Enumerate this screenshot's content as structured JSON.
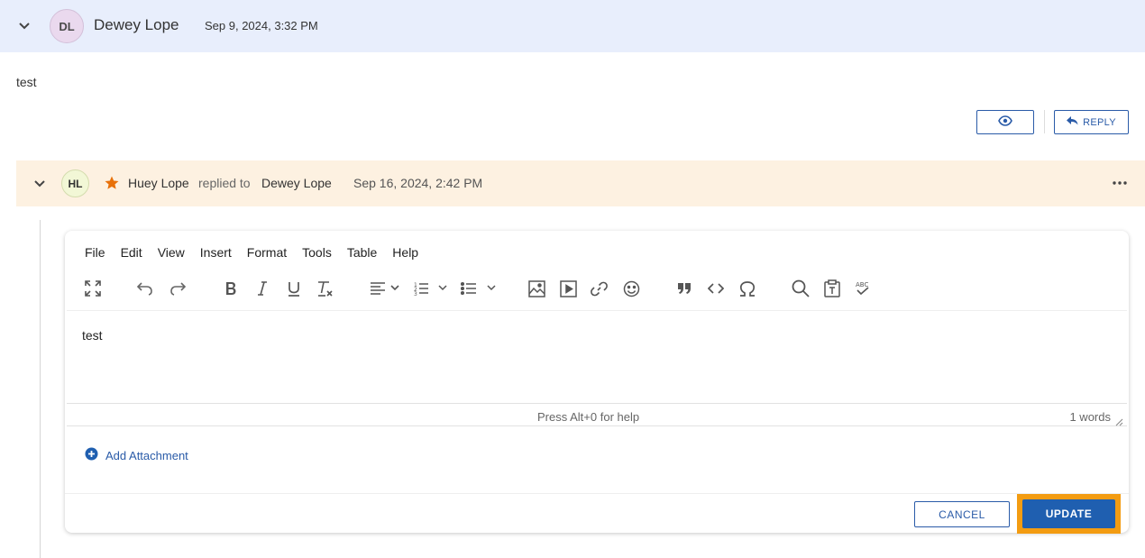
{
  "comment": {
    "author_initials": "DL",
    "author_name": "Dewey Lope",
    "timestamp": "Sep 9, 2024, 3:32 PM",
    "body": "test",
    "reply_label": "REPLY"
  },
  "reply": {
    "author_initials": "HL",
    "author_name": "Huey Lope",
    "replied_to_text": "replied to",
    "target_name": "Dewey Lope",
    "timestamp": "Sep 16, 2024, 2:42 PM"
  },
  "editor": {
    "menu": [
      "File",
      "Edit",
      "View",
      "Insert",
      "Format",
      "Tools",
      "Table",
      "Help"
    ],
    "content": "test",
    "help_text": "Press Alt+0 for help",
    "word_count": "1 words",
    "add_attachment_label": "Add Attachment",
    "cancel_label": "CANCEL",
    "update_label": "UPDATE"
  },
  "colors": {
    "accent": "#2a5ba8",
    "update_bg": "#1f5fb0",
    "highlight": "#f39c12",
    "header1_bg": "#e8eefc",
    "header2_bg": "#fdf1e1",
    "star": "#e8710a"
  }
}
